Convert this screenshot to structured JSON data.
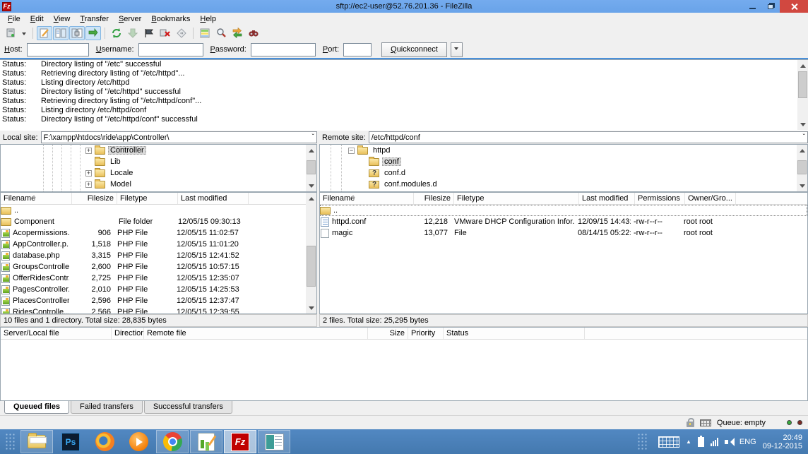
{
  "title_bar": {
    "title": "sftp://ec2-user@52.76.201.36 - FileZilla"
  },
  "brand": {
    "filezilla_initials": "Fz",
    "photoshop_initials": "Ps"
  },
  "menu": [
    {
      "label": "File"
    },
    {
      "label": "Edit"
    },
    {
      "label": "View"
    },
    {
      "label": "Transfer"
    },
    {
      "label": "Server"
    },
    {
      "label": "Bookmarks"
    },
    {
      "label": "Help"
    }
  ],
  "toolbar_icons": [
    "site-manager",
    "site-manager-dropdown",
    "toggle-message-log",
    "toggle-local-tree",
    "toggle-remote-tree",
    "toggle-transfer-queue",
    "refresh",
    "process-queue",
    "cancel-operation",
    "disconnect",
    "reconnect",
    "directory-listing-filters",
    "directory-comparison",
    "synchronized-browsing",
    "find-files"
  ],
  "quickconnect": {
    "host_label": "Host:",
    "username_label": "Username:",
    "password_label": "Password:",
    "port_label": "Port:",
    "button_label": "Quickconnect"
  },
  "log": [
    {
      "prefix": "Status:",
      "message": "Directory listing of \"/etc\" successful"
    },
    {
      "prefix": "Status:",
      "message": "Retrieving directory listing of \"/etc/httpd\"..."
    },
    {
      "prefix": "Status:",
      "message": "Listing directory /etc/httpd"
    },
    {
      "prefix": "Status:",
      "message": "Directory listing of \"/etc/httpd\" successful"
    },
    {
      "prefix": "Status:",
      "message": "Retrieving directory listing of \"/etc/httpd/conf\"..."
    },
    {
      "prefix": "Status:",
      "message": "Listing directory /etc/httpd/conf"
    },
    {
      "prefix": "Status:",
      "message": "Directory listing of \"/etc/httpd/conf\" successful"
    }
  ],
  "local": {
    "label": "Local site:",
    "path": "F:\\xampp\\htdocs\\ride\\app\\Controller\\",
    "tree": [
      {
        "pad": 120,
        "expand": "+",
        "icon": "folder",
        "label": "Controller",
        "flag": "selected"
      },
      {
        "pad": 120,
        "expand": "",
        "icon": "folder",
        "label": "Lib"
      },
      {
        "pad": 120,
        "expand": "+",
        "icon": "folder",
        "label": "Locale"
      },
      {
        "pad": 120,
        "expand": "+",
        "icon": "folder",
        "label": "Model"
      }
    ],
    "columns": [
      {
        "label": "Filename"
      },
      {
        "label": "Filesize"
      },
      {
        "label": "Filetype"
      },
      {
        "label": "Last modified"
      }
    ],
    "files": [
      {
        "icon": "folder",
        "name": "..",
        "size": "",
        "type": "",
        "modified": ""
      },
      {
        "icon": "folder",
        "name": "Component",
        "size": "",
        "type": "File folder",
        "modified": "12/05/15 09:30:13"
      },
      {
        "icon": "php",
        "name": "Acopermissions...",
        "size": "906",
        "type": "PHP File",
        "modified": "12/05/15 11:02:57"
      },
      {
        "icon": "php",
        "name": "AppController.p...",
        "size": "1,518",
        "type": "PHP File",
        "modified": "12/05/15 11:01:20"
      },
      {
        "icon": "php",
        "name": "database.php",
        "size": "3,315",
        "type": "PHP File",
        "modified": "12/05/15 12:41:52"
      },
      {
        "icon": "php",
        "name": "GroupsControlle...",
        "size": "2,600",
        "type": "PHP File",
        "modified": "12/05/15 10:57:15"
      },
      {
        "icon": "php",
        "name": "OfferRidesContr...",
        "size": "2,725",
        "type": "PHP File",
        "modified": "12/05/15 12:35:07"
      },
      {
        "icon": "php",
        "name": "PagesController....",
        "size": "2,010",
        "type": "PHP File",
        "modified": "12/05/15 14:25:53"
      },
      {
        "icon": "php",
        "name": "PlacesController...",
        "size": "2,596",
        "type": "PHP File",
        "modified": "12/05/15 12:37:47"
      },
      {
        "icon": "php",
        "name": "RidesControlle...",
        "size": "2,566",
        "type": "PHP File",
        "modified": "12/05/15 12:39:55"
      }
    ],
    "status": "10 files and 1 directory. Total size: 28,835 bytes"
  },
  "remote": {
    "label": "Remote site:",
    "path": "/etc/httpd/conf",
    "tree": [
      {
        "pad": 40,
        "expand": "−",
        "icon": "folder",
        "label": "httpd"
      },
      {
        "pad": 56,
        "expand": "",
        "icon": "folder",
        "label": "conf",
        "flag": "selected"
      },
      {
        "pad": 56,
        "expand": "",
        "icon": "qfolder",
        "label": "conf.d"
      },
      {
        "pad": 56,
        "expand": "",
        "icon": "qfolder",
        "label": "conf.modules.d"
      }
    ],
    "columns": [
      {
        "label": "Filename"
      },
      {
        "label": "Filesize"
      },
      {
        "label": "Filetype"
      },
      {
        "label": "Last modified"
      },
      {
        "label": "Permissions"
      },
      {
        "label": "Owner/Gro..."
      }
    ],
    "files": [
      {
        "icon": "folder",
        "name": "..",
        "size": "",
        "type": "",
        "modified": "",
        "perms": "",
        "owner": "",
        "flag": "focused"
      },
      {
        "icon": "conf",
        "name": "httpd.conf",
        "size": "12,218",
        "type": "VMware DHCP Configuration Infor...",
        "modified": "12/09/15 14:43:...",
        "perms": "-rw-r--r--",
        "owner": "root root"
      },
      {
        "icon": "file",
        "name": "magic",
        "size": "13,077",
        "type": "File",
        "modified": "08/14/15 05:22:...",
        "perms": "-rw-r--r--",
        "owner": "root root"
      }
    ],
    "status": "2 files. Total size: 25,295 bytes"
  },
  "queue": {
    "columns": [
      {
        "label": "Server/Local file"
      },
      {
        "label": "Direction"
      },
      {
        "label": "Remote file"
      },
      {
        "label": "Size"
      },
      {
        "label": "Priority"
      },
      {
        "label": "Status"
      }
    ],
    "tabs": [
      {
        "label": "Queued files",
        "flag": "active"
      },
      {
        "label": "Failed transfers"
      },
      {
        "label": "Successful transfers"
      }
    ]
  },
  "status_bar": {
    "queue_text": "Queue: empty"
  },
  "taskbar": {
    "icons": [
      "start-grip",
      "file-explorer",
      "photoshop",
      "firefox",
      "media-player",
      "chrome",
      "image-editor",
      "filezilla",
      "system-app"
    ],
    "tray_icons": [
      "touch-keyboard",
      "show-hidden-chevron",
      "power",
      "network-signal",
      "volume"
    ],
    "language": "ENG",
    "time": "20:49",
    "date": "09-12-2015"
  }
}
